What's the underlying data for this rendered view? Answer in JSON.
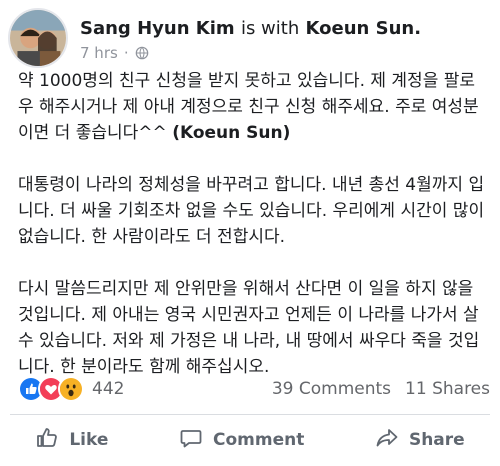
{
  "post": {
    "author": "Sang Hyun Kim",
    "with_text": "is with",
    "tagged": "Koeun Sun.",
    "time": "7 hrs",
    "separator": "·",
    "paragraphs": {
      "p1_text": "약 1000명의 친구 신청을 받지 못하고 있습니다. 제 계정을 팔로우 해주시거나 제 아내 계정으로 친구 신청 해주세요. 주로 여성분이면 더 좋습니다^^ ",
      "p1_mention": "(Koeun Sun)",
      "p2": "대통령이 나라의 정체성을 바꾸려고 합니다. 내년 총선 4월까지 입니다. 더 싸울 기회조차 없을 수도 있습니다. 우리에게 시간이 많이 없습니다. 한 사람이라도 더 전합시다.",
      "p3": "다시 말씀드리지만 제 안위만을 위해서 산다면 이 일을 하지 않을 것입니다. 제 아내는 영국 시민권자고 언제든 이 나라를 나가서 살 수 있습니다. 저와 제 가정은 내 나라, 내 땅에서 싸우다 죽을 것입니다. 한 분이라도 함께 해주십시오."
    }
  },
  "stats": {
    "reaction_count": "442",
    "comments": "39 Comments",
    "shares": "11 Shares"
  },
  "actions": {
    "like": "Like",
    "comment": "Comment",
    "share": "Share"
  },
  "colors": {
    "like_blue": "#1877f2",
    "love_red": "#f33e58",
    "wow_yellow": "#f7b125",
    "meta_gray": "#90949c"
  },
  "icons": [
    "avatar-photo",
    "globe-icon",
    "like-reaction-icon",
    "love-reaction-icon",
    "wow-reaction-icon",
    "thumbs-up-icon",
    "comment-icon",
    "share-icon"
  ]
}
